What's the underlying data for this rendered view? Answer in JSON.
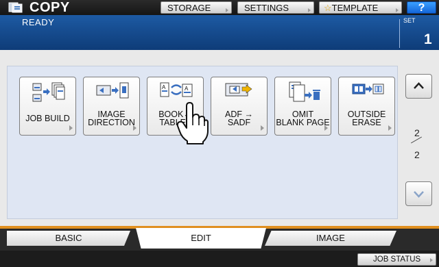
{
  "header": {
    "title": "COPY",
    "storage_label": "STORAGE",
    "settings_label": "SETTINGS",
    "template_label": "TEMPLATE",
    "help_label": "?"
  },
  "status": {
    "message": "READY",
    "set_label": "SET",
    "set_count": "1"
  },
  "functions": [
    {
      "line1": "JOB BUILD",
      "line2": "",
      "icon": "job-build-icon"
    },
    {
      "line1": "IMAGE",
      "line2": "DIRECTION",
      "icon": "image-direction-icon"
    },
    {
      "line1": "BOOK↔",
      "line2": "TABLET",
      "icon": "book-tablet-icon"
    },
    {
      "line1": "ADF →",
      "line2": "SADF",
      "icon": "adf-sadf-icon"
    },
    {
      "line1": "OMIT",
      "line2": "BLANK PAGE",
      "icon": "omit-blank-page-icon"
    },
    {
      "line1": "OUTSIDE",
      "line2": "ERASE",
      "icon": "outside-erase-icon"
    }
  ],
  "pager": {
    "current": "2",
    "total": "2"
  },
  "tabs": [
    {
      "label": "BASIC",
      "active": false
    },
    {
      "label": "EDIT",
      "active": true
    },
    {
      "label": "IMAGE",
      "active": false
    }
  ],
  "footer": {
    "job_status_label": "JOB STATUS"
  },
  "colors": {
    "status_bar": "#1d5aa3",
    "active_tab_line": "#e08f1e",
    "help_button": "#1f78e6"
  }
}
